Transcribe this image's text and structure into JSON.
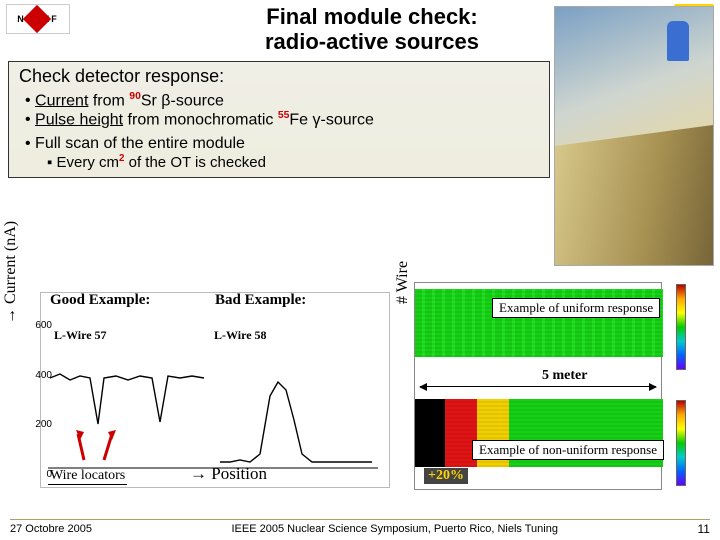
{
  "header": {
    "logo_text": "NI   HEF",
    "title_line1": "Final module check:",
    "title_line2": "radio-active sources",
    "hazard_icon": "☢"
  },
  "check": {
    "heading": "Check detector response:",
    "bullet1_pre": "Current",
    "bullet1_mid": " from ",
    "bullet1_sup": "90",
    "bullet1_post": "Sr β-source",
    "bullet2_pre": "Pulse height",
    "bullet2_mid": " from monochromatic ",
    "bullet2_sup": "55",
    "bullet2_post": "Fe γ-source",
    "bullet3": "Full scan of the entire module",
    "sub_pre": "Every cm",
    "sub_sup": "2",
    "sub_post": " of the OT is checked"
  },
  "plots": {
    "y_left": "→ Current (nA)",
    "y_right": "# Wire",
    "good": "Good Example:",
    "bad": "Bad Example:",
    "lwire_a": "L-Wire 57",
    "lwire_b": "L-Wire 58",
    "tick600": "600",
    "tick400": "400",
    "tick200": "200",
    "tick0": "0",
    "wire_locators": "Wire locators",
    "position": "→ Position",
    "caption_uniform": "Example of uniform response",
    "caption_nonuni": "Example of non-uniform response",
    "fivem": "5 meter",
    "twenty": "+20%"
  },
  "footer": {
    "date": "27 Octobre 2005",
    "venue": "IEEE 2005 Nuclear Science Symposium, Puerto Rico, Niels Tuning",
    "page": "11"
  },
  "chart_data": [
    {
      "type": "line",
      "title": "Good Example: L-Wire 57",
      "ylabel": "Current (nA)",
      "xlabel": "Position",
      "ylim": [
        0,
        650
      ],
      "x": [
        0,
        1,
        2,
        3,
        4,
        5,
        6,
        7,
        8,
        9,
        10,
        11,
        12,
        13,
        14,
        15,
        16,
        17,
        18,
        19,
        20
      ],
      "values": [
        430,
        440,
        420,
        440,
        430,
        250,
        435,
        440,
        420,
        440,
        430,
        445,
        420,
        260,
        435,
        440,
        420,
        440,
        430,
        440,
        430
      ],
      "annotations": [
        "wire locator dip @5",
        "wire locator dip @13"
      ]
    },
    {
      "type": "line",
      "title": "Bad Example: L-Wire 58",
      "ylabel": "Current (nA)",
      "xlabel": "Position",
      "ylim": [
        0,
        650
      ],
      "x": [
        0,
        1,
        2,
        3,
        4,
        5,
        6,
        7,
        8,
        9,
        10,
        11,
        12,
        13,
        14,
        15,
        16,
        17,
        18,
        19,
        20
      ],
      "values": [
        50,
        50,
        60,
        50,
        55,
        80,
        300,
        360,
        320,
        200,
        80,
        55,
        50,
        55,
        50,
        55,
        50,
        55,
        50,
        50,
        50
      ]
    },
    {
      "type": "heatmap",
      "title": "Example of uniform response",
      "xlabel": "Position (≈5 m span)",
      "ylabel": "# Wire",
      "note": "response flat across module"
    },
    {
      "type": "heatmap",
      "title": "Example of non-uniform response",
      "xlabel": "Position (≈5 m span)",
      "ylabel": "# Wire",
      "note": "+20% variation region on left side"
    }
  ]
}
